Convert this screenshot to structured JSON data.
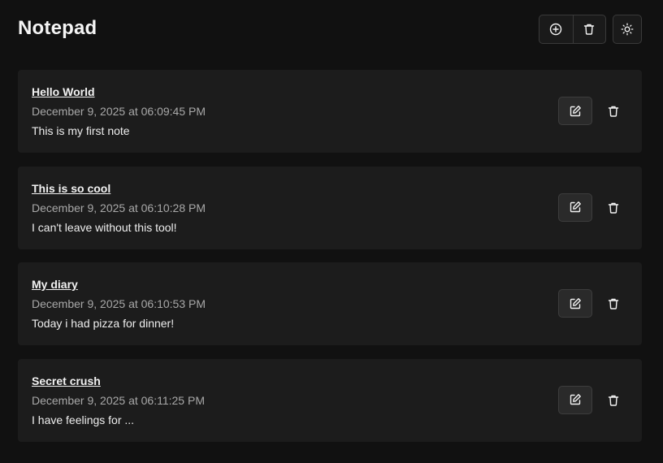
{
  "app": {
    "title": "Notepad"
  },
  "toolbar": {
    "add_icon": "plus-circle-icon",
    "delete_all_icon": "trash-icon",
    "theme_icon": "sun-icon"
  },
  "notes": [
    {
      "title": "Hello World",
      "date": "December 9, 2025 at 06:09:45 PM",
      "body": "This is my first note"
    },
    {
      "title": "This is so cool",
      "date": "December 9, 2025 at 06:10:28 PM",
      "body": "I can't leave without this tool!"
    },
    {
      "title": "My diary",
      "date": "December 9, 2025 at 06:10:53 PM",
      "body": "Today i had pizza for dinner!"
    },
    {
      "title": "Secret crush",
      "date": "December 9, 2025 at 06:11:25 PM",
      "body": "I have feelings for ..."
    }
  ],
  "colors": {
    "background": "#111111",
    "card": "#1c1c1c",
    "text": "#f2f2f2",
    "muted": "#a8a8a8"
  }
}
